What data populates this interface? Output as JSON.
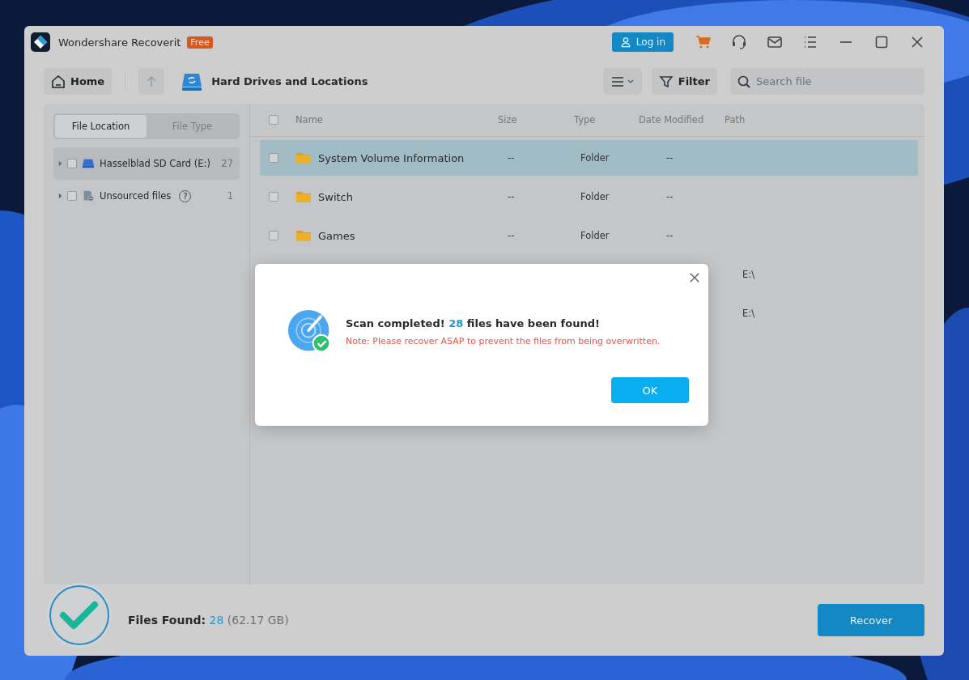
{
  "window": {
    "title": "Wondershare Recoverit",
    "badge": "Free",
    "login": "Log in"
  },
  "toolbar": {
    "home": "Home",
    "location": "Hard Drives and Locations",
    "filter": "Filter",
    "search": {
      "placeholder": "Search file"
    }
  },
  "sidebar": {
    "tabs": [
      {
        "label": "File Location",
        "selected": true
      },
      {
        "label": "File Type",
        "selected": false
      }
    ],
    "items": [
      {
        "label": "Hasselblad SD Card (E:)",
        "count": "27",
        "kind": "drive",
        "selected": true,
        "checked": false
      },
      {
        "label": "Unsourced files",
        "count": "1",
        "kind": "unsourced",
        "help": "?",
        "selected": false,
        "checked": false
      }
    ]
  },
  "table": {
    "select_all_checked": false,
    "columns": [
      "Name",
      "Size",
      "Type",
      "Date Modified",
      "Path"
    ],
    "rows": [
      {
        "name": "System Volume Information",
        "size": "--",
        "type": "Folder",
        "date": "--",
        "selected": true,
        "checked": false
      },
      {
        "name": "Switch",
        "size": "--",
        "type": "Folder",
        "date": "--",
        "selected": false,
        "checked": false
      },
      {
        "name": "Games",
        "size": "--",
        "type": "Folder",
        "date": "--",
        "selected": false,
        "checked": false
      },
      {
        "path": "E:\\"
      },
      {
        "path": "E:\\"
      }
    ]
  },
  "dialog": {
    "message_start": "Scan completed!",
    "message_count": "28",
    "message_end": "files have been found!",
    "note": "Note: Please recover ASAP to prevent the files from being overwritten.",
    "ok": "OK"
  },
  "footer": {
    "label": "Files Found:",
    "count": "28",
    "size": "(62.17 GB)",
    "recover": "Recover"
  }
}
